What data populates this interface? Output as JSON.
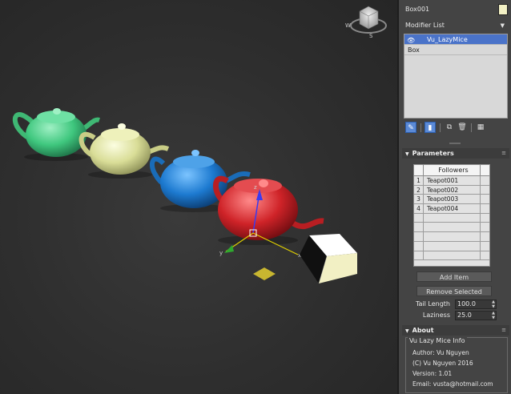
{
  "viewport": {
    "viewcube_labels": [
      "W",
      "S"
    ]
  },
  "panel": {
    "object_name": "Box001",
    "object_color": "#f2f0c4",
    "modifier_list_label": "Modifier List",
    "stack": [
      {
        "label": "Vu_LazyMice",
        "selected": true
      },
      {
        "label": "Box",
        "selected": false
      }
    ],
    "stack_tool_icons": [
      "pin-stack-icon",
      "show-end-result-icon",
      "make-unique-icon",
      "remove-modifier-icon",
      "configure-sets-icon"
    ],
    "parameters": {
      "title": "Parameters",
      "followers_header": "Followers",
      "followers": [
        {
          "index": "1",
          "name": "Teapot001"
        },
        {
          "index": "2",
          "name": "Teapot002"
        },
        {
          "index": "3",
          "name": "Teapot003"
        },
        {
          "index": "4",
          "name": "Teapot004"
        }
      ],
      "add_item": "Add Item",
      "remove_selected": "Remove Selected",
      "tail_length_label": "Tail Length",
      "tail_length_value": "100.0",
      "laziness_label": "Laziness",
      "laziness_value": "25.0"
    },
    "about": {
      "title": "About",
      "group_title": "Vu Lazy Mice Info",
      "author": "Author: Vu Nguyen",
      "copyright": "(C) Vu Nguyen 2016",
      "version": "Version: 1.01",
      "email": "Email: vusta@hotmail.com"
    }
  },
  "colors": {
    "teapot_green": "#4fd18a",
    "teapot_yellow": "#dfe3a0",
    "teapot_blue": "#1f7fd0",
    "teapot_red": "#d0262a",
    "box_color": "#f2f0c4",
    "selection_blue": "#4a73c9"
  }
}
